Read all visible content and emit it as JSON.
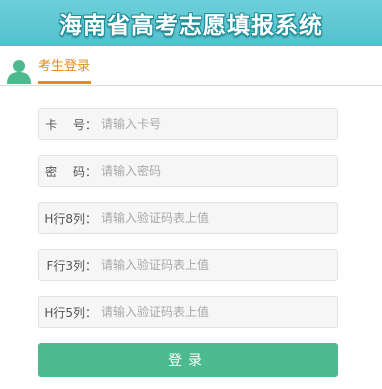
{
  "header": {
    "title": "海南省高考志愿填报系统"
  },
  "tab": {
    "label": "考生登录",
    "icon": "user-icon"
  },
  "form": {
    "fields": [
      {
        "label": "卡　 号：",
        "placeholder": "请输入卡号"
      },
      {
        "label": "密　 码：",
        "placeholder": "请输入密码"
      },
      {
        "label": "H行8列：",
        "placeholder": "请输入验证码表上值"
      },
      {
        "label": "F行3列：",
        "placeholder": "请输入验证码表上值"
      },
      {
        "label": "H行5列：",
        "placeholder": "请输入验证码表上值"
      }
    ],
    "submit_label": "登录"
  },
  "colors": {
    "banner": "#53c1cd",
    "accent": "#e78a17",
    "button": "#4cba8e",
    "user_icon": "#4cba8e"
  }
}
